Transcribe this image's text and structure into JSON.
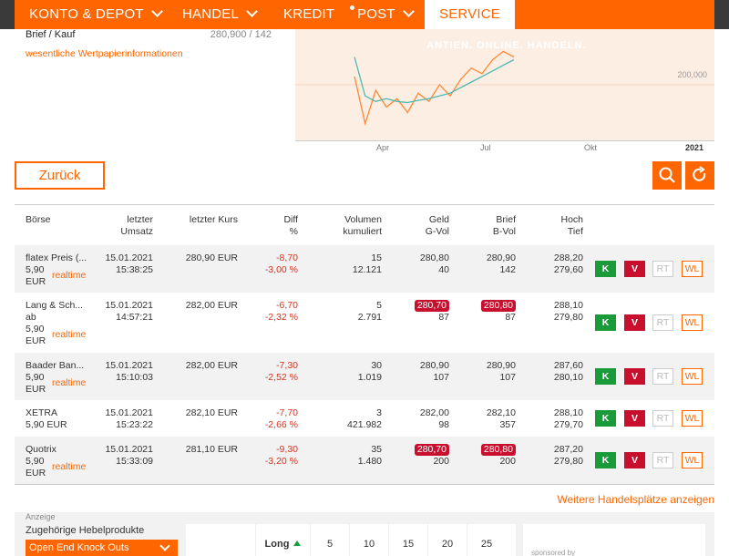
{
  "nav": {
    "items": [
      {
        "label": "KONTO & DEPOT",
        "chevron": true
      },
      {
        "label": "HANDEL",
        "chevron": true
      },
      {
        "label": "KREDIT",
        "chevron": false
      },
      {
        "label": "POST",
        "chevron": true,
        "dot": true
      },
      {
        "label": "SERVICE",
        "chevron": false,
        "active": true
      }
    ]
  },
  "quote": {
    "bid_ask_label": "Brief / Kauf",
    "bid_ask_value": "280,900 / 142",
    "wpi_link": "wesentliche Wertpapierinformationen"
  },
  "chart": {
    "watermark": "ANTIEN. ONLINE. HANDELN.",
    "y_tick": "200,000",
    "x_ticks": [
      "Apr",
      "Jul",
      "Okt",
      "2021"
    ]
  },
  "chart_data": {
    "type": "line",
    "title": "",
    "xlabel": "",
    "ylabel": "",
    "x_ticks": [
      "Apr",
      "Jul",
      "Okt",
      "2021"
    ],
    "y_ticks": [
      "200,000"
    ],
    "series": [
      {
        "values": [
          215,
          130,
          190,
          160,
          175,
          150,
          185,
          170,
          200,
          180,
          210,
          230,
          220,
          245,
          260,
          250
        ]
      },
      {
        "values": [
          250,
          180,
          170,
          175,
          170,
          168,
          172,
          175,
          180,
          185,
          195,
          205,
          215,
          225,
          235,
          245
        ]
      }
    ]
  },
  "actions": {
    "back_label": "Zurück",
    "search_icon": "search-icon",
    "refresh_icon": "refresh-icon"
  },
  "table": {
    "headers": {
      "boerse": "Börse",
      "letzter_umsatz_1": "letzter",
      "letzter_umsatz_2": "Umsatz",
      "letzter_kurs": "letzter Kurs",
      "diff_1": "Diff",
      "diff_2": "%",
      "volumen_1": "Volumen",
      "volumen_2": "kumuliert",
      "geld_1": "Geld",
      "geld_2": "G-Vol",
      "brief_1": "Brief",
      "brief_2": "B-Vol",
      "hoch_1": "Hoch",
      "hoch_2": "Tief"
    },
    "rows": [
      {
        "name": "flatex Preis (...",
        "fee": "5,90",
        "fee_unit": "EUR",
        "realtime": "realtime",
        "date": "15.01.2021",
        "time": "15:38:25",
        "kurs": "280,90 EUR",
        "diff": "-8,70",
        "diff_pct": "-3,00 %",
        "vol": "15",
        "vol_cum": "12.121",
        "geld": "280,80",
        "geld_vol": "40",
        "brief": "280,90",
        "brief_vol": "142",
        "hoch": "288,20",
        "tief": "279,60",
        "geld_hl": false,
        "brief_hl": false
      },
      {
        "name": "Lang & Sch...",
        "name2": "ab",
        "fee": "5,90",
        "fee_unit": "EUR",
        "realtime": "realtime",
        "date": "15.01.2021",
        "time": "14:57:21",
        "kurs": "282,00 EUR",
        "diff": "-6,70",
        "diff_pct": "-2,32 %",
        "vol": "5",
        "vol_cum": "2.791",
        "geld": "280,70",
        "geld_vol": "87",
        "brief": "280,80",
        "brief_vol": "87",
        "hoch": "288,10",
        "tief": "279,80",
        "geld_hl": true,
        "brief_hl": true
      },
      {
        "name": "Baader Ban...",
        "fee": "5,90",
        "fee_unit": "EUR",
        "realtime": "realtime",
        "date": "15.01.2021",
        "time": "15:10:03",
        "kurs": "282,00 EUR",
        "diff": "-7,30",
        "diff_pct": "-2,52 %",
        "vol": "30",
        "vol_cum": "1.019",
        "geld": "280,90",
        "geld_vol": "107",
        "brief": "280,90",
        "brief_vol": "107",
        "hoch": "287,60",
        "tief": "280,10",
        "geld_hl": false,
        "brief_hl": false
      },
      {
        "name": "XETRA",
        "fee_inline": "5,90 EUR",
        "date": "15.01.2021",
        "time": "15:23:22",
        "kurs": "282,10 EUR",
        "diff": "-7,70",
        "diff_pct": "-2,66 %",
        "vol": "3",
        "vol_cum": "421.982",
        "geld": "282,00",
        "geld_vol": "98",
        "brief": "282,10",
        "brief_vol": "357",
        "hoch": "288,10",
        "tief": "279,70",
        "geld_hl": false,
        "brief_hl": false
      },
      {
        "name": "Quotrix",
        "fee": "5,90",
        "fee_unit": "EUR",
        "realtime": "realtime",
        "date": "15.01.2021",
        "time": "15:33:09",
        "kurs": "281,10 EUR",
        "diff": "-9,30",
        "diff_pct": "-3,20 %",
        "vol": "35",
        "vol_cum": "1.480",
        "geld": "280,70",
        "geld_vol": "200",
        "brief": "280,80",
        "brief_vol": "200",
        "hoch": "287,20",
        "tief": "279,80",
        "geld_hl": true,
        "brief_hl": true
      }
    ],
    "buttons": {
      "buy": "K",
      "sell": "V",
      "rt": "RT",
      "wl": "WL"
    },
    "more_link": "Weitere Handelsplätze anzeigen"
  },
  "ad": {
    "label": "Anzeige",
    "title": "Zugehörige Hebelprodukte",
    "select_value": "Open End Knock Outs",
    "cells": [
      "Long",
      "5",
      "10",
      "15",
      "20",
      "25"
    ],
    "sponsor": "sponsored by"
  },
  "colors": {
    "brand": "#ff6600",
    "buy": "#1a9b3a",
    "sell": "#c8102e",
    "negative": "#d9331e"
  }
}
